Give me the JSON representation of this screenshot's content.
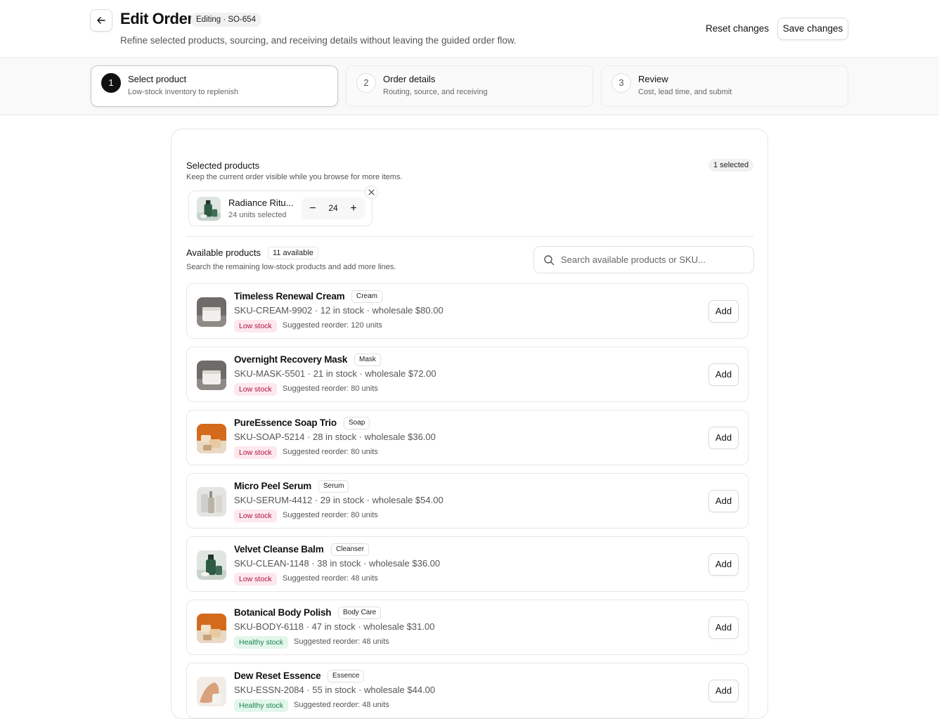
{
  "header": {
    "title": "Edit Order",
    "badge": "Editing · SO-654",
    "subtitle": "Refine selected products, sourcing, and receiving details without leaving the guided order flow.",
    "reset_label": "Reset changes",
    "save_label": "Save changes"
  },
  "steps": [
    {
      "num": "1",
      "title": "Select product",
      "subtitle": "Low-stock inventory to replenish",
      "active": true
    },
    {
      "num": "2",
      "title": "Order details",
      "subtitle": "Routing, source, and receiving",
      "active": false
    },
    {
      "num": "3",
      "title": "Review",
      "subtitle": "Cost, lead time, and submit",
      "active": false
    }
  ],
  "selected": {
    "title": "Selected products",
    "subtitle": "Keep the current order visible while you browse for more items.",
    "count_badge": "1 selected",
    "items": [
      {
        "name": "Radiance Ritu...",
        "units": "24 units selected",
        "qty": "24",
        "image": "green-bottle"
      }
    ]
  },
  "available": {
    "title": "Available products",
    "count_badge": "11 available",
    "subtitle": "Search the remaining low-stock products and add more lines.",
    "search_placeholder": "Search available products or SKU...",
    "add_label": "Add",
    "products": [
      {
        "name": "Timeless Renewal Cream",
        "category": "Cream",
        "meta": "SKU-CREAM-9902 · 12 in stock · wholesale $80.00",
        "stock": "Low stock",
        "stock_level": "low",
        "reorder": "Suggested reorder: 120 units",
        "image": "white-jar"
      },
      {
        "name": "Overnight Recovery Mask",
        "category": "Mask",
        "meta": "SKU-MASK-5501 · 21 in stock · wholesale $72.00",
        "stock": "Low stock",
        "stock_level": "low",
        "reorder": "Suggested reorder: 80 units",
        "image": "white-jar"
      },
      {
        "name": "PureEssence Soap Trio",
        "category": "Soap",
        "meta": "SKU-SOAP-5214 · 28 in stock · wholesale $36.00",
        "stock": "Low stock",
        "stock_level": "low",
        "reorder": "Suggested reorder: 80 units",
        "image": "orange-soap"
      },
      {
        "name": "Micro Peel Serum",
        "category": "Serum",
        "meta": "SKU-SERUM-4412 · 29 in stock · wholesale $54.00",
        "stock": "Low stock",
        "stock_level": "low",
        "reorder": "Suggested reorder: 80 units",
        "image": "serum-dropper"
      },
      {
        "name": "Velvet Cleanse Balm",
        "category": "Cleanser",
        "meta": "SKU-CLEAN-1148 · 38 in stock · wholesale $36.00",
        "stock": "Low stock",
        "stock_level": "low",
        "reorder": "Suggested reorder: 48 units",
        "image": "green-bottle"
      },
      {
        "name": "Botanical Body Polish",
        "category": "Body Care",
        "meta": "SKU-BODY-6118 · 47 in stock · wholesale $31.00",
        "stock": "Healthy stock",
        "stock_level": "healthy",
        "reorder": "Suggested reorder: 48 units",
        "image": "orange-soap"
      },
      {
        "name": "Dew Reset Essence",
        "category": "Essence",
        "meta": "SKU-ESSN-2084 · 55 in stock · wholesale $44.00",
        "stock": "Healthy stock",
        "stock_level": "healthy",
        "reorder": "Suggested reorder: 48 units",
        "image": "hand-cream"
      }
    ]
  }
}
